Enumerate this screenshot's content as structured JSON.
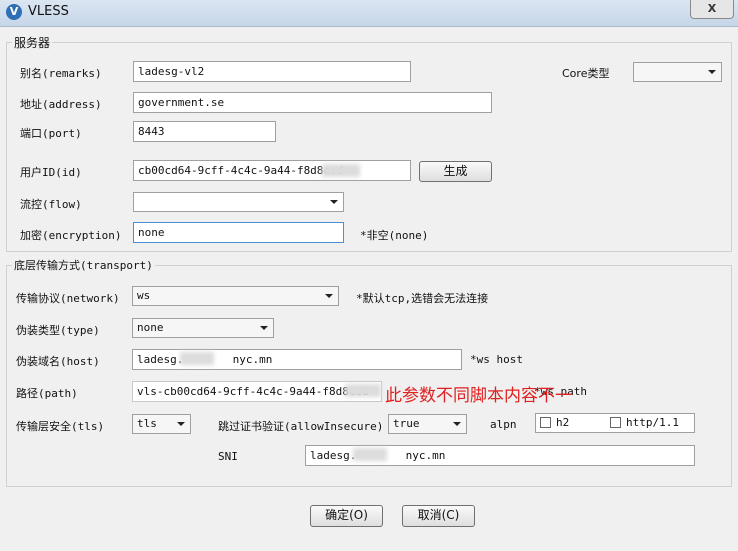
{
  "window": {
    "title": "VLESS",
    "close_label": "X"
  },
  "server": {
    "group_label": "服务器",
    "remarks_label": "别名(remarks)",
    "remarks_value": "ladesg-vl2",
    "core_type_label": "Core类型",
    "core_type_value": "",
    "address_label": "地址(address)",
    "address_value": "government.se",
    "port_label": "端口(port)",
    "port_value": "8443",
    "id_label": "用户ID(id)",
    "id_value": "cb00cd64-9cff-4c4c-9a44-f8d8ccd",
    "generate_label": "生成",
    "flow_label": "流控(flow)",
    "flow_value": "",
    "encryption_label": "加密(encryption)",
    "encryption_value": "none",
    "encryption_hint": "*非空(none)"
  },
  "transport": {
    "group_label": "底层传输方式(transport)",
    "network_label": "传输协议(network)",
    "network_value": "ws",
    "network_hint": "*默认tcp,选错会无法连接",
    "type_label": "伪装类型(type)",
    "type_value": "none",
    "host_label": "伪装域名(host)",
    "host_value_left": "ladesg.",
    "host_value_right": "nyc.mn",
    "host_hint": "*ws host",
    "path_label": "路径(path)",
    "path_value": "vls-cb00cd64-9cff-4c4c-9a44-f8d8ccd",
    "path_hint": "*ws path",
    "path_annotation": "此参数不同脚本内容不一",
    "tls_label": "传输层安全(tls)",
    "tls_value": "tls",
    "allow_insecure_label": "跳过证书验证(allowInsecure)",
    "allow_insecure_value": "true",
    "alpn_label": "alpn",
    "alpn_h2": "h2",
    "alpn_http11": "http/1.1",
    "sni_label": "SNI",
    "sni_value_left": "ladesg.",
    "sni_value_right": "nyc.mn"
  },
  "actions": {
    "ok_label": "确定(O)",
    "cancel_label": "取消(C)"
  }
}
